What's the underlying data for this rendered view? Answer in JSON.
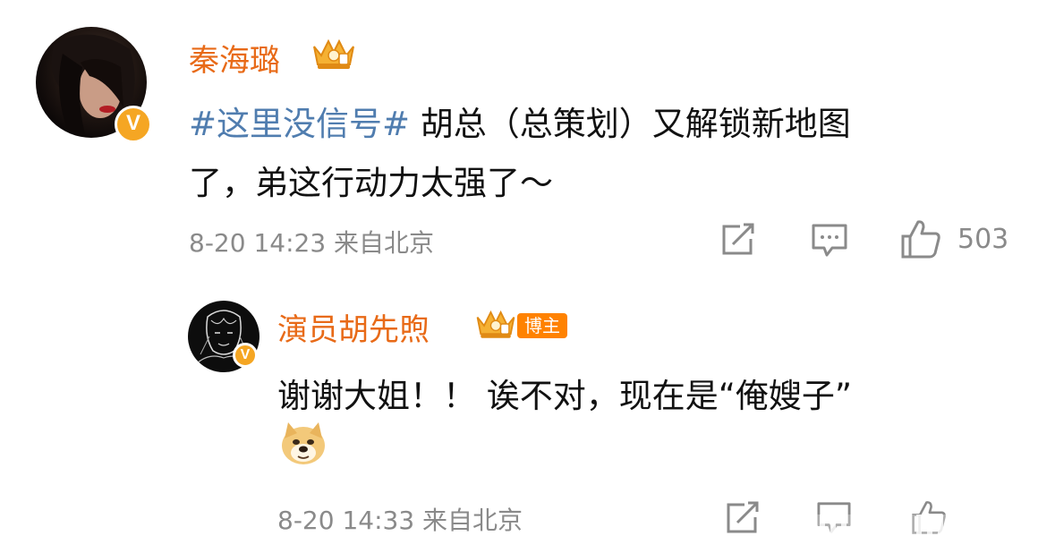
{
  "comment": {
    "author": "秦海璐",
    "hashtag": "#这里没信号#",
    "text_line1": " 胡总（总策划）又解锁新地图",
    "text_line2": "了，弟这行动力太强了～",
    "time": "8-20 14:23",
    "location": "来自北京",
    "like_count": "503",
    "verified_badge": "V",
    "icons": {
      "share": "share-icon",
      "comment": "comment-icon",
      "like": "thumbs-up-icon",
      "crown": "crown-vip-icon"
    }
  },
  "reply": {
    "author": "演员胡先煦",
    "blogger_label": "博主",
    "text": "谢谢大姐！！ 诶不对，现在是“俺嫂子”",
    "emoji": "doge-emoji",
    "time": "8-20 14:33",
    "location": "来自北京",
    "like_count": "",
    "verified_badge": "V"
  },
  "colors": {
    "name": "#e86a17",
    "hashtag": "#507daf",
    "meta": "#8a8a8a",
    "text": "#111111",
    "verified": "#f5a623",
    "blogger_badge": "#ff8200"
  }
}
